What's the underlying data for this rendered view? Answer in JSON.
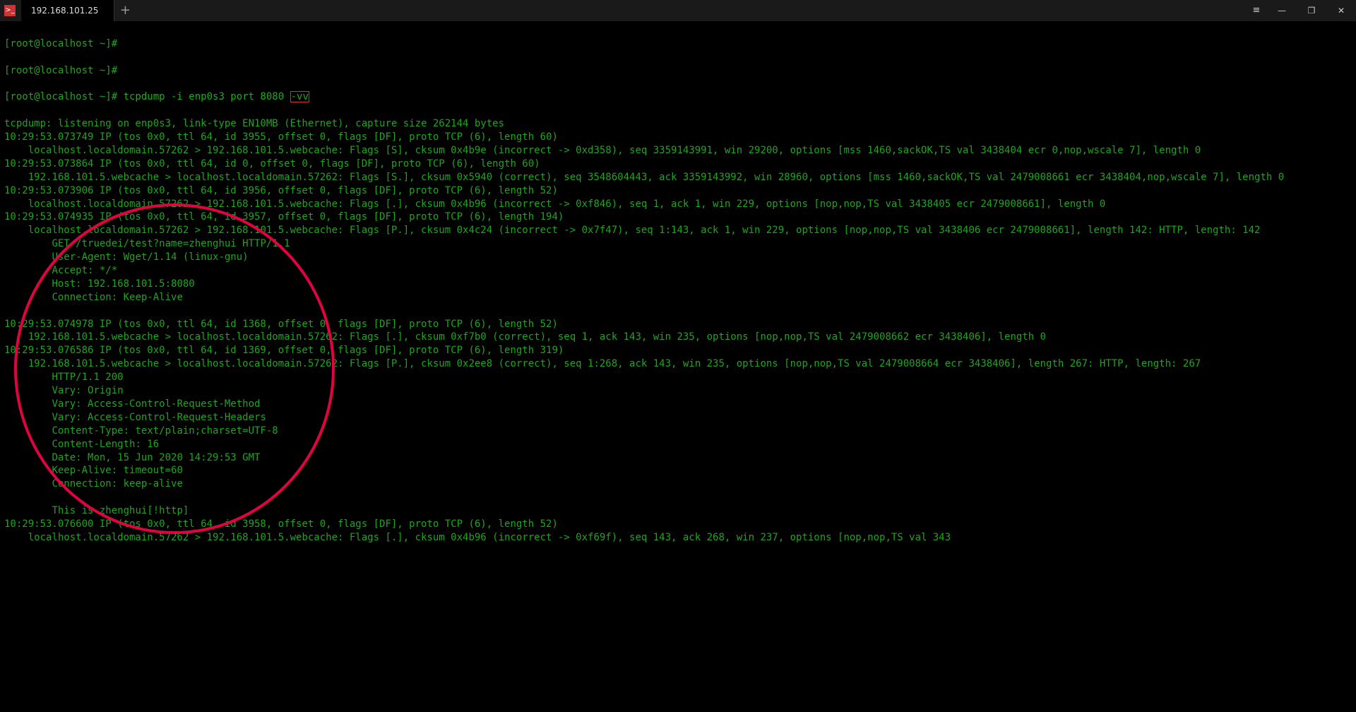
{
  "window": {
    "tab_title": "192.168.101.25",
    "hamburger_glyph": "≡",
    "minimize_glyph": "—",
    "maximize_glyph": "❐",
    "close_glyph": "✕",
    "plus_glyph": "+",
    "app_glyph": ">_"
  },
  "prompt": {
    "line1": "[root@localhost ~]#",
    "line2": "[root@localhost ~]#",
    "line3_prefix": "[root@localhost ~]# ",
    "line3_cmd": "tcpdump -i enp0s3 port 8080 ",
    "line3_flag": "-vv"
  },
  "output": [
    "tcpdump: listening on enp0s3, link-type EN10MB (Ethernet), capture size 262144 bytes",
    "10:29:53.073749 IP (tos 0x0, ttl 64, id 3955, offset 0, flags [DF], proto TCP (6), length 60)",
    "    localhost.localdomain.57262 > 192.168.101.5.webcache: Flags [S], cksum 0x4b9e (incorrect -> 0xd358), seq 3359143991, win 29200, options [mss 1460,sackOK,TS val 3438404 ecr 0,nop,wscale 7], length 0",
    "10:29:53.073864 IP (tos 0x0, ttl 64, id 0, offset 0, flags [DF], proto TCP (6), length 60)",
    "    192.168.101.5.webcache > localhost.localdomain.57262: Flags [S.], cksum 0x5940 (correct), seq 3548604443, ack 3359143992, win 28960, options [mss 1460,sackOK,TS val 2479008661 ecr 3438404,nop,wscale 7], length 0",
    "10:29:53.073906 IP (tos 0x0, ttl 64, id 3956, offset 0, flags [DF], proto TCP (6), length 52)",
    "    localhost.localdomain.57262 > 192.168.101.5.webcache: Flags [.], cksum 0x4b96 (incorrect -> 0xf846), seq 1, ack 1, win 229, options [nop,nop,TS val 3438405 ecr 2479008661], length 0",
    "10:29:53.074935 IP (tos 0x0, ttl 64, id 3957, offset 0, flags [DF], proto TCP (6), length 194)",
    "    localhost.localdomain.57262 > 192.168.101.5.webcache: Flags [P.], cksum 0x4c24 (incorrect -> 0x7f47), seq 1:143, ack 1, win 229, options [nop,nop,TS val 3438406 ecr 2479008661], length 142: HTTP, length: 142",
    "        GET /truedei/test?name=zhenghui HTTP/1.1",
    "        User-Agent: Wget/1.14 (linux-gnu)",
    "        Accept: */*",
    "        Host: 192.168.101.5:8080",
    "        Connection: Keep-Alive",
    "",
    "10:29:53.074978 IP (tos 0x0, ttl 64, id 1368, offset 0, flags [DF], proto TCP (6), length 52)",
    "    192.168.101.5.webcache > localhost.localdomain.57262: Flags [.], cksum 0xf7b0 (correct), seq 1, ack 143, win 235, options [nop,nop,TS val 2479008662 ecr 3438406], length 0",
    "10:29:53.076586 IP (tos 0x0, ttl 64, id 1369, offset 0, flags [DF], proto TCP (6), length 319)",
    "    192.168.101.5.webcache > localhost.localdomain.57262: Flags [P.], cksum 0x2ee8 (correct), seq 1:268, ack 143, win 235, options [nop,nop,TS val 2479008664 ecr 3438406], length 267: HTTP, length: 267",
    "        HTTP/1.1 200",
    "        Vary: Origin",
    "        Vary: Access-Control-Request-Method",
    "        Vary: Access-Control-Request-Headers",
    "        Content-Type: text/plain;charset=UTF-8",
    "        Content-Length: 16",
    "        Date: Mon, 15 Jun 2020 14:29:53 GMT",
    "        Keep-Alive: timeout=60",
    "        Connection: keep-alive",
    "",
    "        This is zhenghui[!http]",
    "10:29:53.076600 IP (tos 0x0, ttl 64, id 3958, offset 0, flags [DF], proto TCP (6), length 52)",
    "    localhost.localdomain.57262 > 192.168.101.5.webcache: Flags [.], cksum 0x4b96 (incorrect -> 0xf69f), seq 143, ack 268, win 237, options [nop,nop,TS val 343"
  ]
}
